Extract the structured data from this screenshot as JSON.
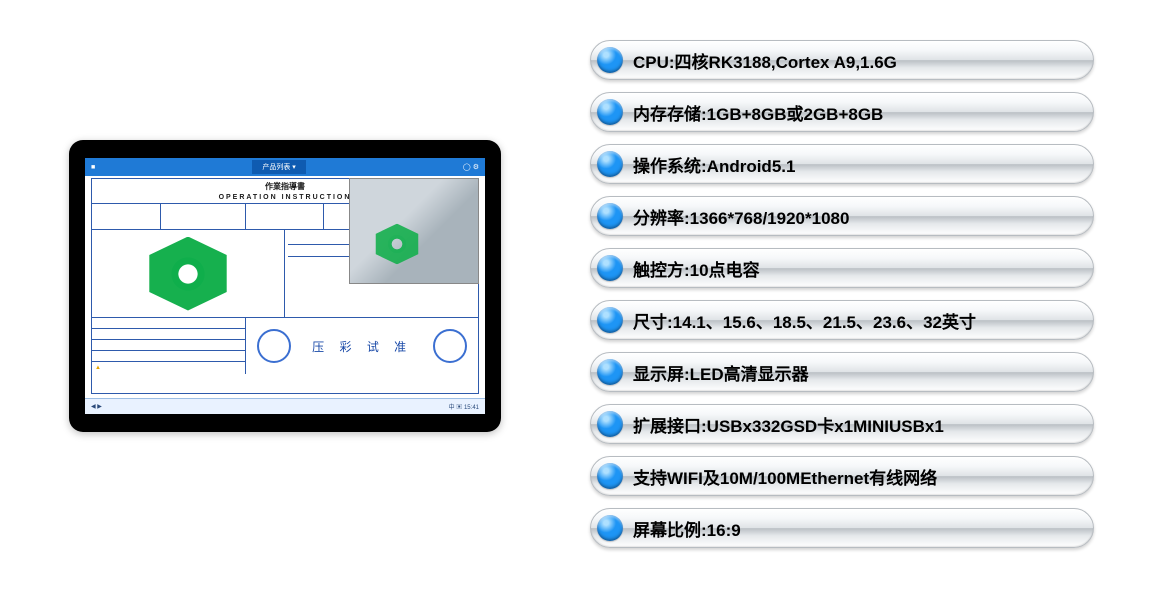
{
  "device_screen": {
    "doc_title_cn": "作業指導書",
    "doc_title_en": "OPERATION   INSTRUCTION",
    "stamp_text": "压 彩\n试 准",
    "taskbar_left": "◀ ▶",
    "taskbar_right": "中 ▣ 15:41",
    "topbar_tab": "产品列表 ▾"
  },
  "specs": [
    {
      "label": "CPU:四核RK3188,Cortex A9,1.6G"
    },
    {
      "label": "内存存储:1GB+8GB或2GB+8GB"
    },
    {
      "label": "操作系统:Android5.1"
    },
    {
      "label": "分辨率:1366*768/1920*1080"
    },
    {
      "label": "触控方:10点电容"
    },
    {
      "label": "尺寸:14.1、15.6、18.5、21.5、23.6、32英寸"
    },
    {
      "label": "显示屏:LED高清显示器"
    },
    {
      "label": "扩展接口:USBx332GSD卡x1MINIUSBx1"
    },
    {
      "label": "支持WIFI及10M/100MEthernet有线网络"
    },
    {
      "label": "屏幕比例:16:9"
    }
  ]
}
